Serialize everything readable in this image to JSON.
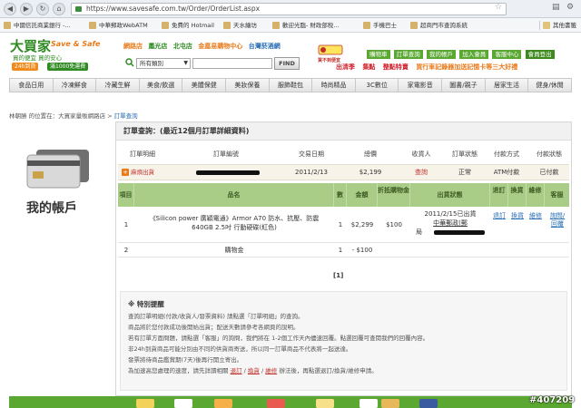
{
  "browser": {
    "url": "https://www.savesafe.com.tw/Order/OrderList.aspx",
    "bookmarks": [
      "中國信託商業銀行 -...",
      "中華郵政WebATM",
      "免費的 Hotmail",
      "天水繪坊",
      "歡迎光臨- 財政部稅...",
      "手機巴士",
      "超商門市查詢系統"
    ],
    "other_bookmarks": "其他書籤"
  },
  "site": {
    "logo_text": "大買家",
    "logo_en": "Save & Safe",
    "slogan": "買的便宜 買的安心",
    "badge_24h": "24h到貨",
    "badge_free": "滿1000免運費",
    "top_links": [
      "網路店",
      "鳳光店",
      "北屯店",
      "金嘉易購物中心",
      "台灣菸酒網"
    ],
    "search_category": "所有類別",
    "search_button": "FIND",
    "promo_badge": "買不到便宜",
    "member_nav": [
      "購物車",
      "訂單查詢",
      "我的帳戶",
      "加入會員",
      "客服中心",
      "會員登出"
    ],
    "promos": [
      "出清季",
      "集點",
      "整點特賣",
      "買行車記錄器加送記憶卡等三大好禮"
    ]
  },
  "categories": [
    "食品日用",
    "冷凍鮮食",
    "冷藏生鮮",
    "美食/飲選",
    "美體保健",
    "美妝保養",
    "服飾鞋包",
    "時尚精品",
    "3C數位",
    "家電影音",
    "圖書/親子",
    "居家生活",
    "健身/休閒"
  ],
  "breadcrumb": {
    "prefix": "林朝勝 的位置在：大買家量販網路店 >",
    "current": "訂單查詢"
  },
  "sidebar": {
    "title": "我的帳戶"
  },
  "order_query": {
    "title": "訂單查詢：(最近12個月訂單詳細資料)",
    "headers": [
      "訂單明細",
      "訂單編號",
      "交易日期",
      "總價",
      "收貨人",
      "訂單狀態",
      "付款方式",
      "付款狀態"
    ],
    "row": {
      "detail_button": "麻煩出貨",
      "date": "2011/2/13",
      "total": "$2,199",
      "receiver_link": "查詢",
      "status": "正常",
      "payment_method": "ATM付款",
      "payment_status": "已付款"
    }
  },
  "items": {
    "headers": {
      "item": "項目",
      "name": "品名",
      "qty": "數量",
      "amount": "金額",
      "discount": "折抵購物金",
      "shipping": "出貨狀態",
      "return": "退訂",
      "exchange": "換貨",
      "repair": "維修",
      "service": "客服"
    },
    "rows": [
      {
        "no": "1",
        "name_line1": "《Silicon power 廣穎電通》Armor A70 防水、抗壓、防震",
        "name_line2": "640GB 2.5吋 行動硬碟(紅色)",
        "qty": "1",
        "amount": "$2,299",
        "discount": "$100",
        "ship_line1": "2011/2/15已出貨",
        "ship_line2": "中華郵政(郵",
        "ship_line3": "局",
        "return_link": "退訂",
        "exchange_link": "換貨",
        "repair_link": "維修",
        "service_link1": "詢問/",
        "service_link2": "回覆"
      },
      {
        "no": "2",
        "name_line1": "購物金",
        "qty": "1",
        "amount": "- $100"
      }
    ]
  },
  "pager": "[1]",
  "notice": {
    "title": "※ 特別提醒",
    "lines": [
      "查詢訂單明細(付款/收貨人/發票資料) 請點選「訂單明細」的查詢。",
      "商品將於您付款成功後開始出貨；配送天數請參考各網頁的說明。",
      "若有訂單方面問題，請點選「客服」的詢問，我們將在 1-2個工作天內儘速回覆。點選回覆可查閱我們的回覆內容。",
      "非24h到貨商品可能分別由不同的供貨商寄送，所以同一訂單商品不代表將一起送達。",
      "發票將待商品鑑賞期(7天)後再行開立寄出。",
      "為加速高您處理的速度，請先詳讀相關"
    ],
    "last_links": [
      "退訂",
      "換貨",
      "維修"
    ],
    "last_suffix": "辦法後，再點選退訂/換貨/維修申請。"
  },
  "watermark": "#407209"
}
